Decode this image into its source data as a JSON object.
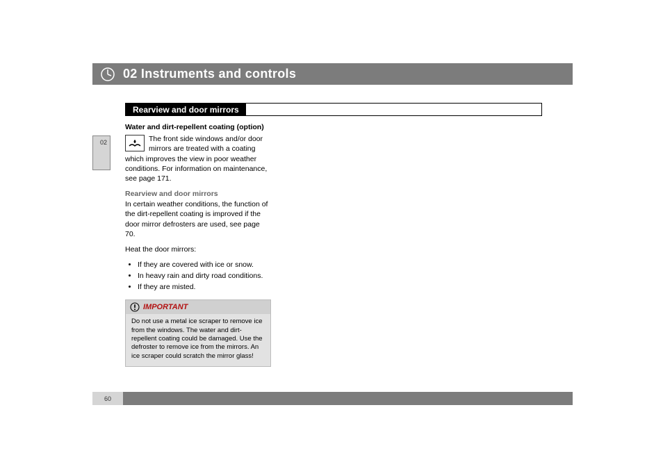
{
  "page_tab": {
    "num": "02"
  },
  "header": {
    "chapter": "02 Instruments and controls"
  },
  "section": {
    "title": "Rearview and door mirrors"
  },
  "content": {
    "sub1_title": "Water and dirt-repellent coating (option)",
    "sub1_body": "The front side windows and/or door mirrors are treated with a coating which improves the view in poor weather conditions. For information on maintenance, see page 171.",
    "sub2_title": "Rearview and door mirrors",
    "sub2_body": "In certain weather conditions, the function of the dirt-repellent coating is improved if the door mirror defrosters are used, see page 70.",
    "heat_intro": "Heat the door mirrors:",
    "bullets": [
      "If they are covered with ice or snow.",
      "In heavy rain and dirty road conditions.",
      "If they are misted."
    ]
  },
  "callout": {
    "title": "IMPORTANT",
    "body": "Do not use a metal ice scraper to remove ice from the windows. The water and dirt-repellent coating could be damaged. Use the defroster to remove ice from the mirrors. An ice scraper could scratch the mirror glass!"
  },
  "footer": {
    "page_num": "60"
  }
}
